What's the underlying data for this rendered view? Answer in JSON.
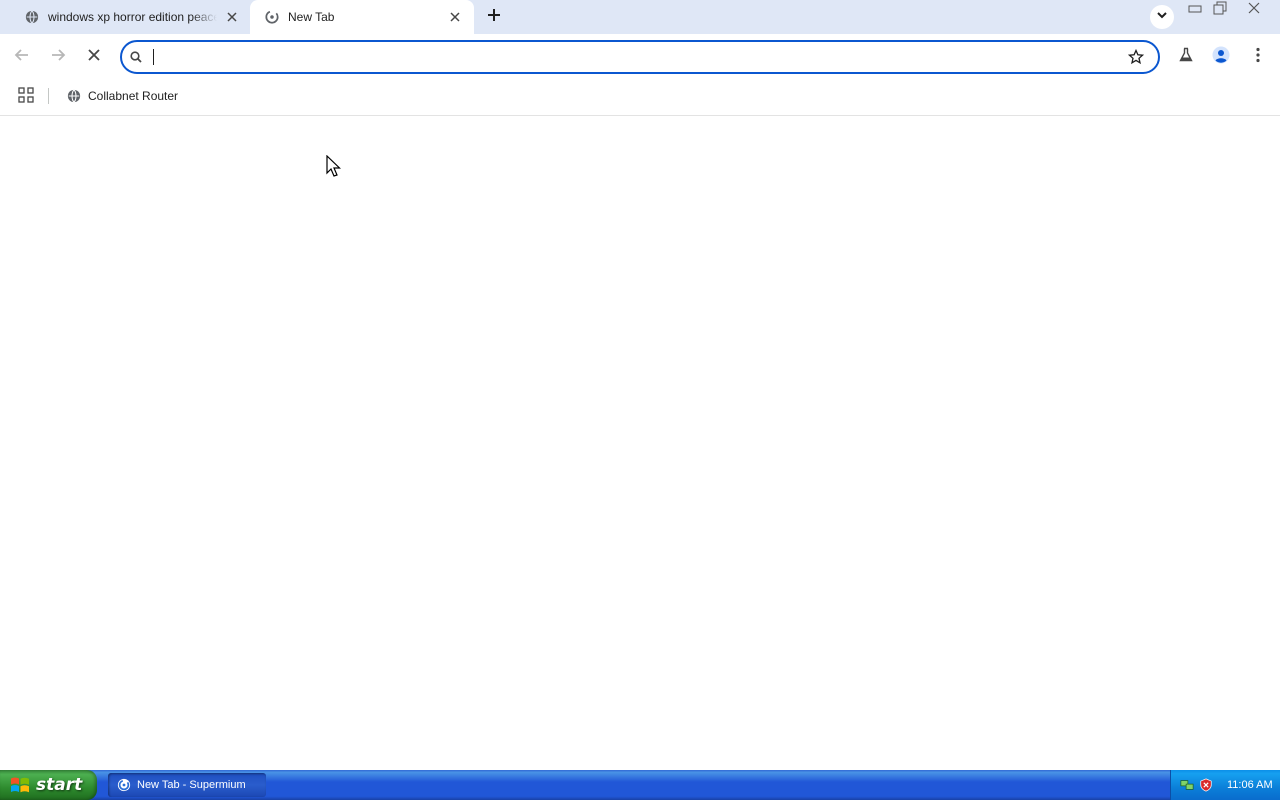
{
  "tabs": [
    {
      "title": "windows xp horror edition peaceful",
      "active": false,
      "favicon": "globe-icon"
    },
    {
      "title": "New Tab",
      "active": true,
      "favicon": "supermium-icon"
    }
  ],
  "toolbar": {
    "omnibox": {
      "value": "",
      "placeholder": ""
    }
  },
  "bookmarks": [
    {
      "label": "Collabnet Router",
      "favicon": "globe-icon"
    }
  ],
  "taskbar": {
    "start_label": "start",
    "task_label": "New Tab - Supermium",
    "clock": "11:06 AM"
  },
  "colors": {
    "tabstrip_bg": "#dfe7f6",
    "omnibox_focus": "#0b57d0",
    "taskbar_blue": "#2157d7",
    "start_green": "#2e8b2e",
    "tray_blue": "#0b7fd8"
  }
}
